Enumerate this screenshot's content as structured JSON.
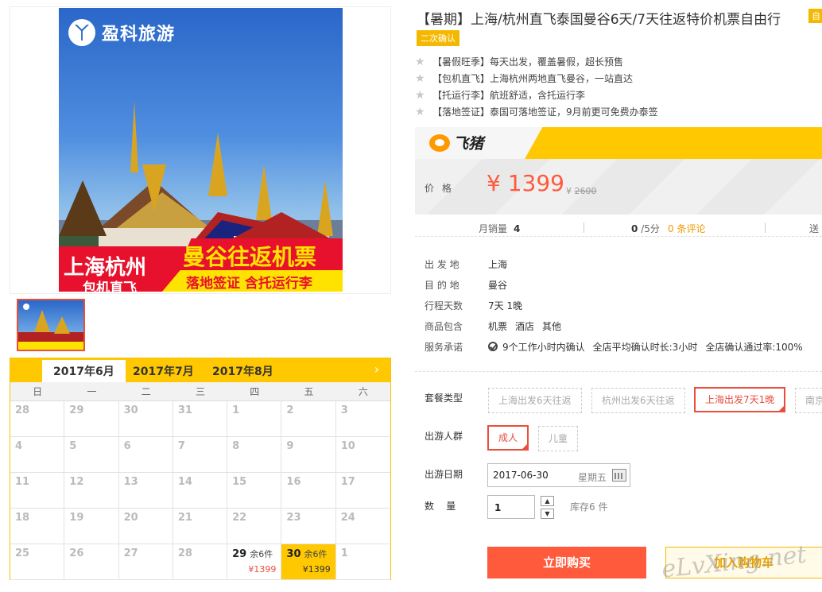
{
  "product": {
    "title": "【暑期】上海/杭州直飞泰国曼谷6天/7天往返特价机票自由行",
    "tag_auto": "自",
    "tag_confirm": "二次确认",
    "image": {
      "brand": "盈科旅游",
      "left_line1": "上海杭州",
      "left_line2": "包机直飞",
      "right_line1": "曼谷往返机票",
      "right_line2": "落地签证    含托运行李"
    },
    "features": [
      "【暑假旺季】每天出发，覆盖暑假，超长预售",
      "【包机直飞】上海杭州两地直飞曼谷，一站直达",
      "【托运行李】航班舒适，含托运行李",
      "【落地签证】泰国可落地签证，9月前更可免费办泰签"
    ]
  },
  "platform": {
    "name": "飞猪"
  },
  "price": {
    "label": "价格",
    "current": "¥ 1399",
    "original": "2600",
    "original_prefix": "¥"
  },
  "stats": {
    "sales_label": "月销量",
    "sales_value": "4",
    "score_value": "0",
    "score_suffix": "/5分",
    "reviews": "0 条评论",
    "gift": "送"
  },
  "attrs": [
    {
      "k": "出 发 地",
      "v": "上海"
    },
    {
      "k": "目 的 地",
      "v": "曼谷"
    },
    {
      "k": "行程天数",
      "v": "7天 1晚"
    },
    {
      "k": "商品包含",
      "items": [
        "机票",
        "酒店",
        "其他"
      ]
    },
    {
      "k": "服务承诺",
      "items": [
        "9个工作小时内确认",
        "全店平均确认时长:3小时",
        "全店确认通过率:100%"
      ]
    }
  ],
  "options": {
    "package_label": "套餐类型",
    "packages": [
      "上海出发6天往返",
      "杭州出发6天往返",
      "上海出发7天1晚",
      "南京"
    ],
    "selected_package": 2,
    "traveler_label": "出游人群",
    "travelers": [
      "成人",
      "儿童"
    ],
    "selected_traveler": 0,
    "date_label": "出游日期",
    "date_value": "2017-06-30",
    "date_weekday": "星期五",
    "qty_label": "数    量",
    "qty_value": "1",
    "stock": "库存6 件"
  },
  "buttons": {
    "buy": "立即购买",
    "cart": "加入购物车"
  },
  "calendar": {
    "tabs": [
      "2017年6月",
      "2017年7月",
      "2017年8月"
    ],
    "active_tab": 0,
    "next_arrow": "›",
    "weekdays": [
      "日",
      "一",
      "二",
      "三",
      "四",
      "五",
      "六"
    ],
    "days": [
      {
        "d": "28"
      },
      {
        "d": "29"
      },
      {
        "d": "30"
      },
      {
        "d": "31"
      },
      {
        "d": "1"
      },
      {
        "d": "2"
      },
      {
        "d": "3"
      },
      {
        "d": "4"
      },
      {
        "d": "5"
      },
      {
        "d": "6"
      },
      {
        "d": "7"
      },
      {
        "d": "8"
      },
      {
        "d": "9"
      },
      {
        "d": "10"
      },
      {
        "d": "11"
      },
      {
        "d": "12"
      },
      {
        "d": "13"
      },
      {
        "d": "14"
      },
      {
        "d": "15"
      },
      {
        "d": "16"
      },
      {
        "d": "17"
      },
      {
        "d": "18"
      },
      {
        "d": "19"
      },
      {
        "d": "20"
      },
      {
        "d": "21"
      },
      {
        "d": "22"
      },
      {
        "d": "23"
      },
      {
        "d": "24"
      },
      {
        "d": "25"
      },
      {
        "d": "26"
      },
      {
        "d": "27"
      },
      {
        "d": "28"
      },
      {
        "d": "29",
        "stock": "余6件",
        "price": "¥1399",
        "avail": true
      },
      {
        "d": "30",
        "stock": "余6件",
        "price": "¥1399",
        "avail": true,
        "selected": true
      },
      {
        "d": "1"
      }
    ]
  },
  "watermark": "eLvXing.net"
}
